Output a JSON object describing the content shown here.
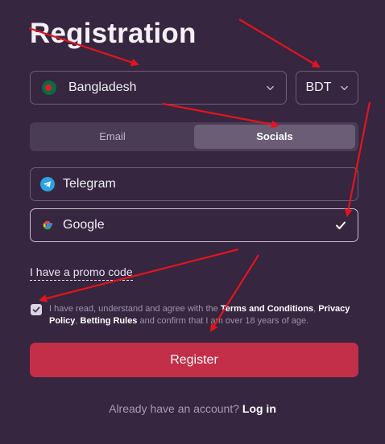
{
  "page": {
    "title": "Registration"
  },
  "country": {
    "value": "Bangladesh",
    "flag_icon": "bangladesh-flag-icon"
  },
  "currency": {
    "value": "BDT"
  },
  "tabs": [
    {
      "label": "Email",
      "active": false
    },
    {
      "label": "Socials",
      "active": true
    }
  ],
  "socials": {
    "telegram": {
      "label": "Telegram",
      "icon": "telegram-icon"
    },
    "google": {
      "label": "Google",
      "icon": "google-icon",
      "selected": true
    }
  },
  "promo": {
    "label": "I have a promo code"
  },
  "agreement": {
    "checked": true,
    "text_1": "I have read, understand and agree with the ",
    "terms": "Terms and Conditions",
    "text_2": ", ",
    "privacy": "Privacy Policy",
    "text_3": ", ",
    "betting": "Betting Rules",
    "text_4": " and confirm that I am over 18 years of age."
  },
  "register": {
    "label": "Register"
  },
  "login": {
    "prompt": "Already have an account?",
    "link": "Log in"
  },
  "colors": {
    "background": "#362640",
    "primary_button": "#c32e48",
    "annotation_arrow": "#e3141e"
  }
}
